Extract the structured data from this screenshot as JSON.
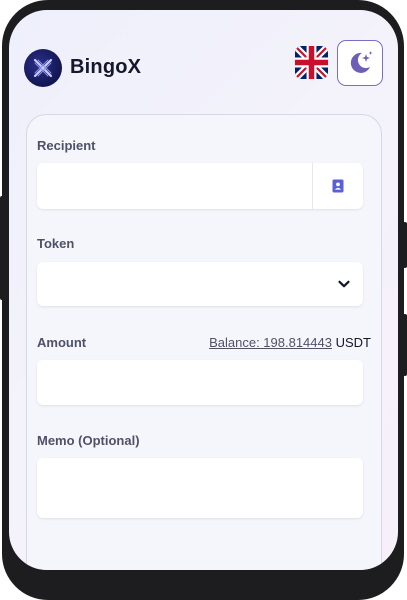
{
  "header": {
    "brand_name": "BingoX",
    "logo_icon": "bingox-logo-icon",
    "language_icon": "uk-flag-icon",
    "theme_icon": "moon-stars-icon",
    "accent_color": "#7b6fc4"
  },
  "form": {
    "recipient": {
      "label": "Recipient",
      "value": "",
      "contact_icon": "contact-book-icon"
    },
    "token": {
      "label": "Token",
      "value": "",
      "dropdown_icon": "chevron-down-icon"
    },
    "amount": {
      "label": "Amount",
      "value": "",
      "balance_label": "Balance: 198.814443",
      "balance_unit": "USDT"
    },
    "memo": {
      "label": "Memo (Optional)",
      "value": ""
    }
  }
}
